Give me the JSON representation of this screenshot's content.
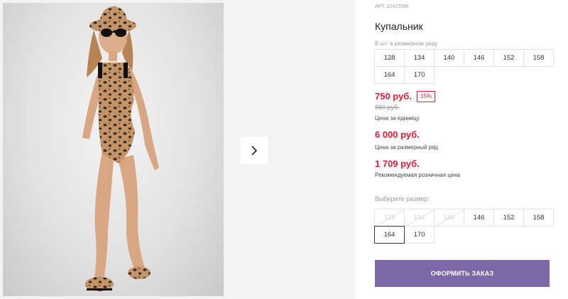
{
  "gallery": {
    "next_icon": "chevron-right-icon"
  },
  "product": {
    "sku": "АРТ. 12421596",
    "title": "Купальник",
    "row_label": "В шт. в размерном ряду",
    "row_sizes": [
      "128",
      "134",
      "140",
      "146",
      "152",
      "158",
      "164",
      "170"
    ],
    "price": "750 руб.",
    "discount": "15%",
    "old_price": "880 руб.",
    "price_note": "Цена за единицу",
    "row_price": "6 000 руб.",
    "row_price_note": "Цена за размерный ряд",
    "rrp": "1 709 руб.",
    "rrp_note": "Рекомендуемая розничная цена",
    "choose_label": "Выберите размер:",
    "sizes": [
      {
        "label": "128",
        "state": "disabled"
      },
      {
        "label": "134",
        "state": "disabled"
      },
      {
        "label": "140",
        "state": "disabled"
      },
      {
        "label": "146",
        "state": "available"
      },
      {
        "label": "152",
        "state": "available"
      },
      {
        "label": "158",
        "state": "available"
      },
      {
        "label": "164",
        "state": "selected"
      },
      {
        "label": "170",
        "state": "available"
      }
    ],
    "order_button": "ОФОРМИТЬ ЗАКАЗ"
  },
  "colors": {
    "accent_red": "#e31d35",
    "order_button": "#7c68a6"
  }
}
